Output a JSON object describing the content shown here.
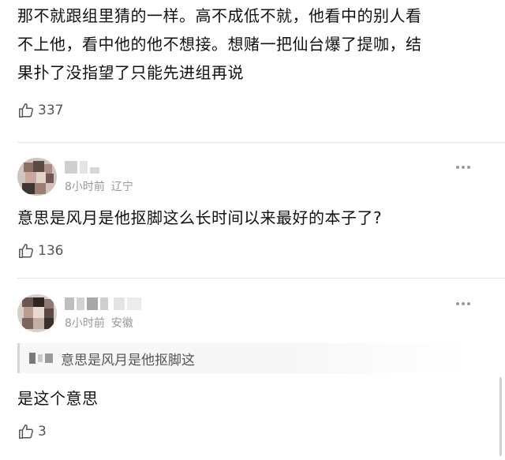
{
  "comments": [
    {
      "text_lines": [
        "那不就跟组里猜的一样。高不成低不就，他看中的别人看",
        "不上他，看中他的他不想接。想赌一把仙台爆了提咖，结",
        "果扑了没指望了只能先进组再说"
      ],
      "likes": "337"
    },
    {
      "time": "8小时前",
      "location": "辽宁",
      "text": "意思是风月是他抠脚这么长时间以来最好的本子了?",
      "likes": "136"
    },
    {
      "time": "8小时前",
      "location": "安徽",
      "quote_text": "意思是风月是他抠脚这",
      "text": "是这个意思",
      "likes": "3"
    }
  ],
  "icons": {
    "like": "thumbs-up-icon",
    "more": "more-dots-icon"
  },
  "colors": {
    "meta_gray": "#999999",
    "divider": "#e6e6e6"
  }
}
